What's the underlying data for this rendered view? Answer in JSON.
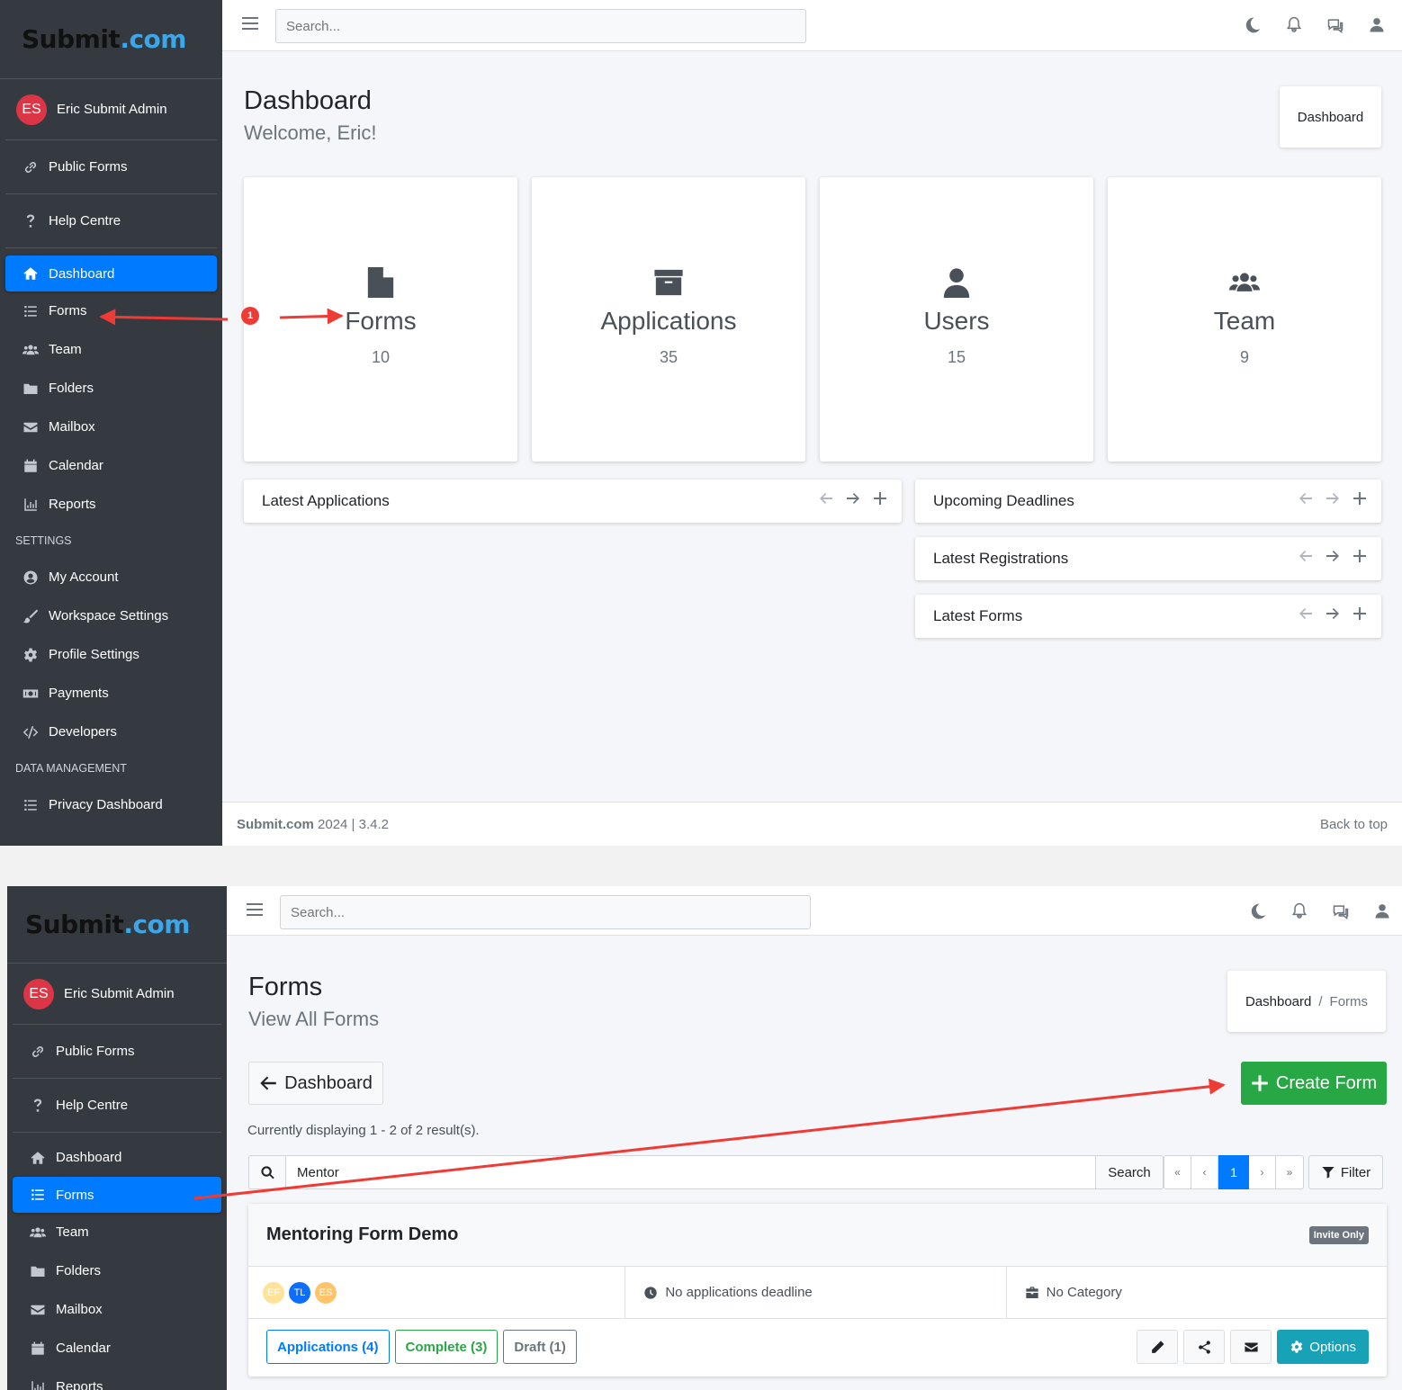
{
  "brand": {
    "part1": "Submit",
    "part2": ".com"
  },
  "user": {
    "initials": "ES",
    "name": "Eric Submit Admin"
  },
  "sidebar": {
    "top_links": [
      {
        "label": "Public Forms",
        "icon": "link-icon"
      },
      {
        "label": "Help Centre",
        "icon": "question-icon"
      }
    ],
    "main_links": [
      {
        "label": "Dashboard",
        "icon": "home-icon"
      },
      {
        "label": "Forms",
        "icon": "list-icon"
      },
      {
        "label": "Team",
        "icon": "users-icon"
      },
      {
        "label": "Folders",
        "icon": "folder-icon"
      },
      {
        "label": "Mailbox",
        "icon": "envelope-icon"
      },
      {
        "label": "Calendar",
        "icon": "calendar-icon"
      },
      {
        "label": "Reports",
        "icon": "chart-icon"
      }
    ],
    "settings_header": "SETTINGS",
    "settings_links": [
      {
        "label": "My Account",
        "icon": "user-circle-icon"
      },
      {
        "label": "Workspace Settings",
        "icon": "brush-icon"
      },
      {
        "label": "Profile Settings",
        "icon": "gear-icon"
      },
      {
        "label": "Payments",
        "icon": "money-icon"
      },
      {
        "label": "Developers",
        "icon": "code-icon"
      }
    ],
    "data_header": "DATA MANAGEMENT",
    "data_links": [
      {
        "label": "Privacy Dashboard",
        "icon": "list-icon"
      }
    ],
    "shot2_partial_label": "Reports"
  },
  "topbar": {
    "search_placeholder": "Search..."
  },
  "dashboard": {
    "title": "Dashboard",
    "subtitle": "Welcome, Eric!",
    "breadcrumb": "Dashboard",
    "stats": [
      {
        "label": "Forms",
        "value": "10",
        "icon": "file-icon"
      },
      {
        "label": "Applications",
        "value": "35",
        "icon": "archive-icon"
      },
      {
        "label": "Users",
        "value": "15",
        "icon": "user-icon"
      },
      {
        "label": "Team",
        "value": "9",
        "icon": "users-icon"
      }
    ],
    "panels": {
      "latest_applications": "Latest Applications",
      "upcoming_deadlines": "Upcoming Deadlines",
      "latest_registrations": "Latest Registrations",
      "latest_forms": "Latest Forms"
    },
    "footer": {
      "brand": "Submit.com",
      "year_version": " 2024 | 3.4.2",
      "back_to_top": "Back to top"
    }
  },
  "annotation": {
    "step": "1",
    "color": "#ef3b36"
  },
  "forms_page": {
    "title": "Forms",
    "subtitle": "View All Forms",
    "breadcrumb_home": "Dashboard",
    "breadcrumb_sep": "/",
    "breadcrumb_current": "Forms",
    "back_button": "Dashboard",
    "create_button": "Create Form",
    "displaying": "Currently displaying 1 - 2 of 2 result(s).",
    "search_value": "Mentor",
    "search_button": "Search",
    "pagination": [
      "«",
      "‹",
      "1",
      "›",
      "»"
    ],
    "filter_button": "Filter",
    "form_card": {
      "title": "Mentoring Form Demo",
      "badge": "Invite Only",
      "avatars": [
        {
          "initials": "EF",
          "color": "#ffe39a"
        },
        {
          "initials": "TL",
          "color": "#0d6efd"
        },
        {
          "initials": "ES",
          "color": "#ffc46b"
        }
      ],
      "deadline": "No applications deadline",
      "category": "No Category",
      "applications": "Applications (4)",
      "complete": "Complete (3)",
      "draft": "Draft (1)",
      "options": "Options"
    }
  },
  "colors": {
    "sidebar": "#343a40",
    "primary": "#007bff",
    "success": "#28a745",
    "info": "#17a2b8",
    "danger": "#dc3545"
  }
}
